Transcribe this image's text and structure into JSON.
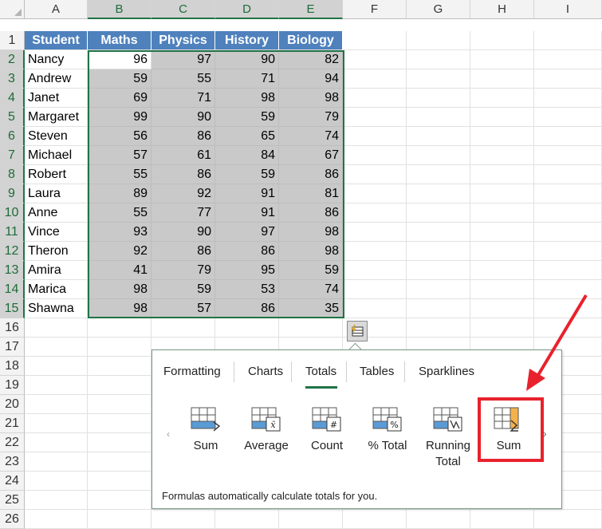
{
  "columns": [
    "A",
    "B",
    "C",
    "D",
    "E",
    "F",
    "G",
    "H",
    "I"
  ],
  "rows": [
    "1",
    "2",
    "3",
    "4",
    "5",
    "6",
    "7",
    "8",
    "9",
    "10",
    "11",
    "12",
    "13",
    "14",
    "15",
    "16",
    "17",
    "18",
    "19",
    "20",
    "21",
    "22",
    "23",
    "24",
    "25",
    "26"
  ],
  "table": {
    "headers": [
      "Student",
      "Maths",
      "Physics",
      "History",
      "Biology"
    ],
    "data": [
      [
        "Nancy",
        "96",
        "97",
        "90",
        "82"
      ],
      [
        "Andrew",
        "59",
        "55",
        "71",
        "94"
      ],
      [
        "Janet",
        "69",
        "71",
        "98",
        "98"
      ],
      [
        "Margaret",
        "99",
        "90",
        "59",
        "79"
      ],
      [
        "Steven",
        "56",
        "86",
        "65",
        "74"
      ],
      [
        "Michael",
        "57",
        "61",
        "84",
        "67"
      ],
      [
        "Robert",
        "55",
        "86",
        "59",
        "86"
      ],
      [
        "Laura",
        "89",
        "92",
        "91",
        "81"
      ],
      [
        "Anne",
        "55",
        "77",
        "91",
        "86"
      ],
      [
        "Vince",
        "93",
        "90",
        "97",
        "98"
      ],
      [
        "Theron",
        "92",
        "86",
        "86",
        "98"
      ],
      [
        "Amira",
        "41",
        "79",
        "95",
        "59"
      ],
      [
        "Marica",
        "98",
        "59",
        "53",
        "74"
      ],
      [
        "Shawna",
        "98",
        "57",
        "86",
        "35"
      ]
    ]
  },
  "quick_analysis": {
    "tabs": [
      "Formatting",
      "Charts",
      "Totals",
      "Tables",
      "Sparklines"
    ],
    "active_tab": "Totals",
    "tiles": [
      {
        "label": "Sum",
        "icon": "sum-row-icon"
      },
      {
        "label": "Average",
        "icon": "average-icon"
      },
      {
        "label": "Count",
        "icon": "count-icon"
      },
      {
        "label": "% Total",
        "icon": "percent-total-icon"
      },
      {
        "label": "Running Total",
        "icon": "running-total-icon"
      },
      {
        "label": "Sum",
        "icon": "sum-column-icon"
      }
    ],
    "footer": "Formulas automatically calculate totals for you."
  },
  "colors": {
    "header_blue": "#4f81bd",
    "selection_green": "#217346",
    "highlight_red": "#e8222d",
    "shade_gray": "#c9c9c9",
    "tile_blue": "#5b9bd5",
    "tile_orange": "#f4b24a"
  }
}
